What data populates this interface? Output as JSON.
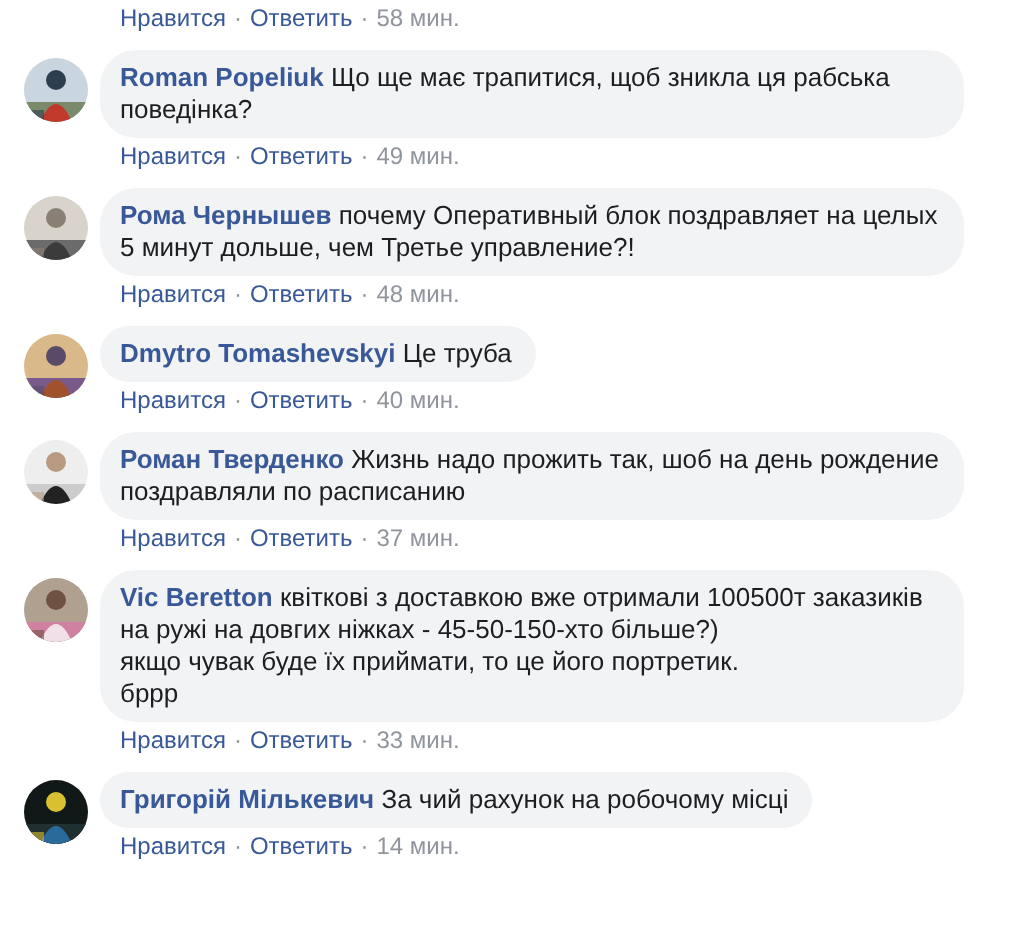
{
  "previous_actions": {
    "like": "Нравится",
    "separator": "·",
    "reply": "Ответить",
    "time": "58 мин."
  },
  "comments": [
    {
      "author": "Roman Popeliuk",
      "text": "Що ще має трапитися, щоб зникла ця рабська поведінка?",
      "like": "Нравится",
      "separator": "·",
      "reply": "Ответить",
      "time": "49 мин."
    },
    {
      "author": "Рома Чернышев",
      "text": "почему Оперативный блок поздравляет на целых 5 минут дольше, чем Третье управление?!",
      "like": "Нравится",
      "separator": "·",
      "reply": "Ответить",
      "time": "48 мин."
    },
    {
      "author": "Dmytro Tomashevskyi",
      "text": "Це труба",
      "like": "Нравится",
      "separator": "·",
      "reply": "Ответить",
      "time": "40 мин."
    },
    {
      "author": "Роман Тверденко",
      "text": "Жизнь надо прожить так, шоб на день рождение поздравляли по расписанию",
      "like": "Нравится",
      "separator": "·",
      "reply": "Ответить",
      "time": "37 мин."
    },
    {
      "author": "Vic Beretton",
      "text": "квіткові з доставкою вже отримали 100500т заказиків на ружі на довгих ніжках - 45-50-150-хто більше?)\nякщо чувак буде їх приймати, то це його портретик.\nбррр",
      "like": "Нравится",
      "separator": "·",
      "reply": "Ответить",
      "time": "33 мин."
    },
    {
      "author": "Григорій Мількевич",
      "text": "За чий рахунок на робочому місці",
      "like": "Нравится",
      "separator": "·",
      "reply": "Ответить",
      "time": "14 мин."
    }
  ]
}
